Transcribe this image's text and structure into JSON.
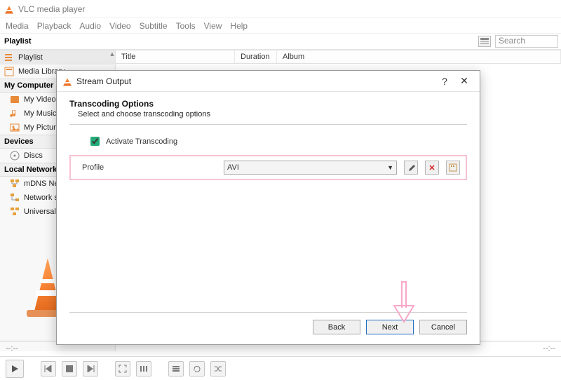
{
  "titlebar": {
    "app_name": "VLC media player"
  },
  "menubar": [
    "Media",
    "Playback",
    "Audio",
    "Video",
    "Subtitle",
    "Tools",
    "View",
    "Help"
  ],
  "playlist_header": "Playlist",
  "search_placeholder": "Search",
  "columns": {
    "title": "Title",
    "duration": "Duration",
    "album": "Album"
  },
  "sidebar": {
    "items": [
      {
        "label": "Playlist",
        "icon": "playlist-icon",
        "selected": true
      },
      {
        "label": "Media Library",
        "icon": "media-library-icon"
      }
    ],
    "my_computer_header": "My Computer",
    "my_computer": [
      {
        "label": "My Videos",
        "icon": "video-icon"
      },
      {
        "label": "My Music",
        "icon": "music-icon"
      },
      {
        "label": "My Pictures",
        "icon": "picture-icon"
      }
    ],
    "devices_header": "Devices",
    "devices": [
      {
        "label": "Discs",
        "icon": "disc-icon"
      }
    ],
    "local_header": "Local Network",
    "local": [
      {
        "label": "mDNS Net",
        "icon": "network-icon"
      },
      {
        "label": "Network s",
        "icon": "network-icon"
      },
      {
        "label": "Universal I",
        "icon": "network-icon"
      }
    ]
  },
  "timeline": {
    "left": "--:--",
    "right": "--:--"
  },
  "dialog": {
    "title": "Stream Output",
    "heading": "Transcoding Options",
    "subheading": "Select and choose transcoding options",
    "activate_label": "Activate Transcoding",
    "activate_checked": true,
    "profile_label": "Profile",
    "profile_value": "AVI",
    "buttons": {
      "back": "Back",
      "next": "Next",
      "cancel": "Cancel"
    }
  }
}
